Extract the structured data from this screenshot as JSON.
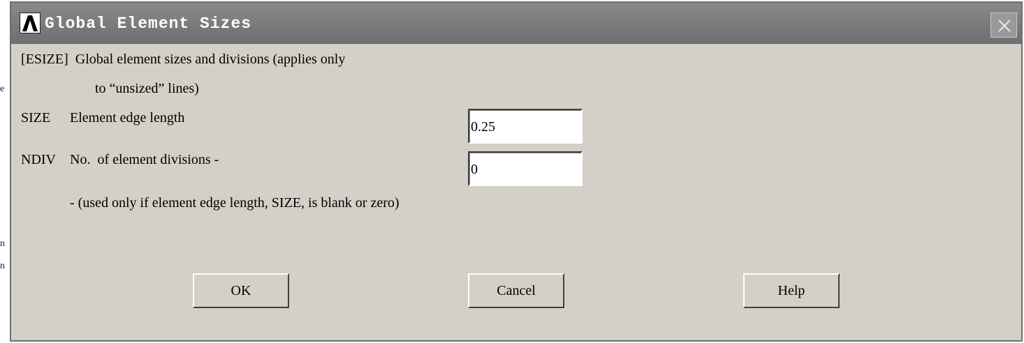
{
  "background_fragments": [
    "e",
    "n",
    "n"
  ],
  "dialog": {
    "title": "Global Element Sizes",
    "description_line1": "[ESIZE]  Global element sizes and divisions (applies only",
    "description_line2": "to “unsized” lines)",
    "size_key": "SIZE",
    "size_label": "Element edge length",
    "size_value": "0.25",
    "ndiv_key": "NDIV",
    "ndiv_label": "No.  of element divisions -",
    "ndiv_value": "0",
    "note": "- (used only if element edge length, SIZE, is blank or zero)",
    "buttons": {
      "ok": "OK",
      "cancel": "Cancel",
      "help": "Help"
    }
  },
  "colors": {
    "dialog_bg": "#d4d0c8",
    "titlebar": "#7a7a7a",
    "title_text": "#ffffff"
  },
  "icons": [
    "ansys-logo-icon",
    "close-icon"
  ]
}
